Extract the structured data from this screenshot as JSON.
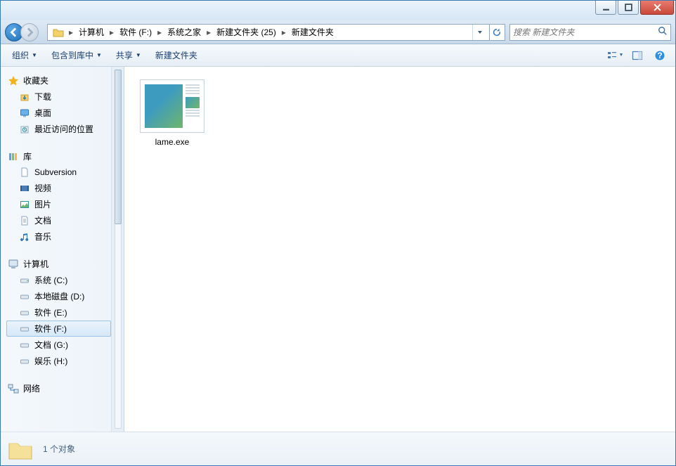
{
  "breadcrumbs": [
    "计算机",
    "软件 (F:)",
    "系统之家",
    "新建文件夹 (25)",
    "新建文件夹"
  ],
  "search": {
    "placeholder": "搜索 新建文件夹"
  },
  "toolbar": {
    "organize": "组织",
    "include": "包含到库中",
    "share": "共享",
    "new_folder": "新建文件夹"
  },
  "nav": {
    "favorites": {
      "label": "收藏夹",
      "children": [
        {
          "id": "downloads",
          "label": "下载"
        },
        {
          "id": "desktop",
          "label": "桌面"
        },
        {
          "id": "recent",
          "label": "最近访问的位置"
        }
      ]
    },
    "libraries": {
      "label": "库",
      "children": [
        {
          "id": "subversion",
          "label": "Subversion"
        },
        {
          "id": "videos",
          "label": "视频"
        },
        {
          "id": "pictures",
          "label": "图片"
        },
        {
          "id": "documents",
          "label": "文档"
        },
        {
          "id": "music",
          "label": "音乐"
        }
      ]
    },
    "computer": {
      "label": "计算机",
      "children": [
        {
          "id": "drive-c",
          "label": "系统 (C:)"
        },
        {
          "id": "drive-d",
          "label": "本地磁盘 (D:)"
        },
        {
          "id": "drive-e",
          "label": "软件 (E:)"
        },
        {
          "id": "drive-f",
          "label": "软件 (F:)",
          "selected": true
        },
        {
          "id": "drive-g",
          "label": "文档 (G:)"
        },
        {
          "id": "drive-h",
          "label": "娱乐 (H:)"
        }
      ]
    },
    "network": {
      "label": "网络"
    }
  },
  "files": [
    {
      "name": "lame.exe"
    }
  ],
  "details": {
    "count_text": "1 个对象"
  }
}
